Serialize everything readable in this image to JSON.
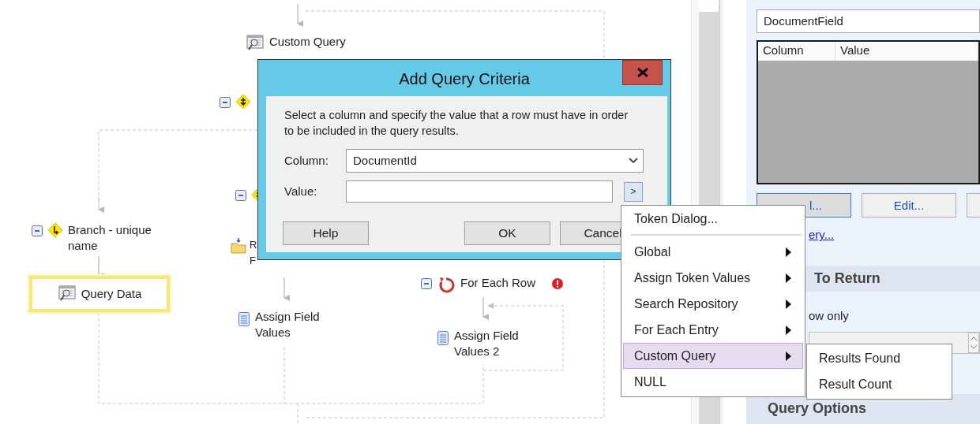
{
  "canvas": {
    "nodes": [
      {
        "kind": "query",
        "label": "Custom Query",
        "collapsible": false,
        "selected": false,
        "error": false
      },
      {
        "kind": "decision",
        "collapsible": true,
        "selected": false,
        "error": false
      },
      {
        "kind": "decision",
        "collapsible": true,
        "selected": false,
        "error": false
      },
      {
        "kind": "branch",
        "label": "Branch - unique name",
        "collapsible": true,
        "selected": false,
        "error": false
      },
      {
        "kind": "folder",
        "label": "R F",
        "collapsible": false,
        "selected": false,
        "error": false
      },
      {
        "kind": "query",
        "label": "Query Data",
        "collapsible": false,
        "selected": true,
        "error": false
      },
      {
        "kind": "assign",
        "label": "Assign Field Values",
        "collapsible": false,
        "selected": false,
        "error": false
      },
      {
        "kind": "loop",
        "label": "For Each Row",
        "collapsible": true,
        "selected": false,
        "error": true
      },
      {
        "kind": "assign",
        "label": "Assign Field Values 2",
        "collapsible": false,
        "selected": false,
        "error": false
      }
    ]
  },
  "dialog": {
    "title": "Add Query Criteria",
    "description": "Select a column and specify the value that a row must have in order to be included in the query results.",
    "column": {
      "label": "Column:",
      "value": "DocumentId"
    },
    "value": {
      "label": "Value:",
      "button": ">"
    },
    "buttons": [
      {
        "kind": "help",
        "label": "Help"
      },
      {
        "kind": "ok",
        "label": "OK"
      },
      {
        "kind": "cancel",
        "label": "Cancel"
      }
    ]
  },
  "token_menu": {
    "items": [
      {
        "kind": "item",
        "label": "Token Dialog...",
        "submenu": false,
        "selected": false
      },
      {
        "kind": "separator"
      },
      {
        "kind": "item",
        "label": "Global",
        "submenu": true,
        "selected": false
      },
      {
        "kind": "item",
        "label": "Assign Token Values",
        "submenu": true,
        "selected": false
      },
      {
        "kind": "item",
        "label": "Search Repository",
        "submenu": true,
        "selected": false
      },
      {
        "kind": "item",
        "label": "For Each Entry",
        "submenu": true,
        "selected": false
      },
      {
        "kind": "item",
        "label": "Custom Query",
        "submenu": true,
        "selected": true
      },
      {
        "kind": "item",
        "label": "NULL",
        "submenu": false,
        "selected": false
      }
    ],
    "submenu": {
      "items": [
        "Results Found",
        "Result Count"
      ]
    }
  },
  "properties": {
    "table_field": "DocumentField",
    "criteria_columns": [
      "Column",
      "Value"
    ],
    "buttons": [
      "l...",
      "Edit..."
    ],
    "link": "ery...",
    "sections": [
      {
        "title": "To Return",
        "option": "ow only"
      },
      {
        "title": "Query Options"
      }
    ]
  }
}
